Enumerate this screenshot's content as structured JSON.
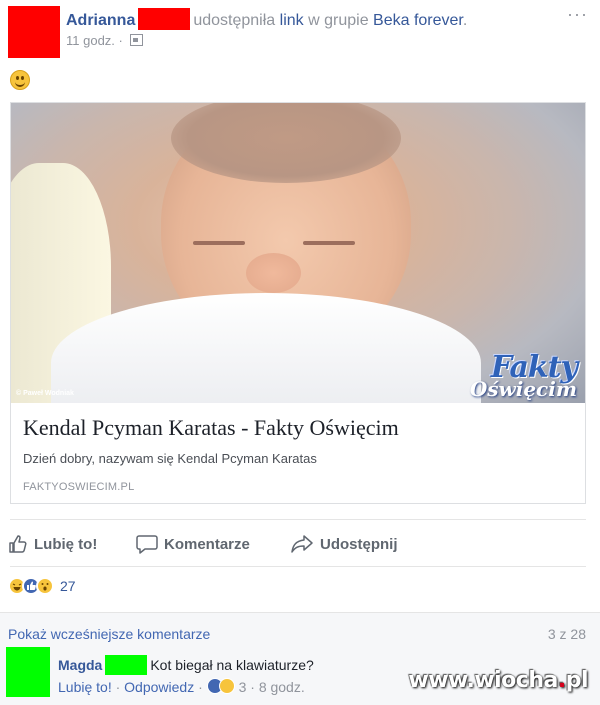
{
  "post": {
    "author": "Adrianna",
    "shared_text": "udostępniła",
    "link_word": "link",
    "in_group_text": "w grupie",
    "group": "Beka forever",
    "period": ".",
    "time": "11 godz.",
    "separator": "·",
    "more": "···",
    "message_icon": "slightly-smiling-emoji"
  },
  "link_card": {
    "title": "Kendal Pcyman Karatas - Fakty Oświęcim",
    "description": "Dzień dobry, nazywam się Kendal Pcyman Karatas",
    "domain": "FAKTYOSWIECIM.PL",
    "photo_credit": "© Paweł Wodniak",
    "logo_line1": "Fakty",
    "logo_line2": "Oświęcim"
  },
  "actions": {
    "like": "Lubię to!",
    "comment": "Komentarze",
    "share": "Udostępnij"
  },
  "reactions": {
    "types": [
      "haha",
      "like",
      "wow"
    ],
    "count": "27"
  },
  "comments": {
    "show_previous": "Pokaż wcześniejsze komentarze",
    "counter": "3 z 28",
    "items": [
      {
        "author": "Magda",
        "text": "Kot biegał na klawiaturze?",
        "like": "Lubię to!",
        "reply": "Odpowiedz",
        "reaction_count": "3",
        "time": "8 godz."
      }
    ]
  },
  "watermark": {
    "text": "www.wiocha",
    "dot": ".",
    "tld": "pl"
  },
  "colors": {
    "link_blue": "#365899",
    "grey_text": "#90949c",
    "redaction_red": "#ff0000",
    "redaction_green": "#00ff00"
  }
}
